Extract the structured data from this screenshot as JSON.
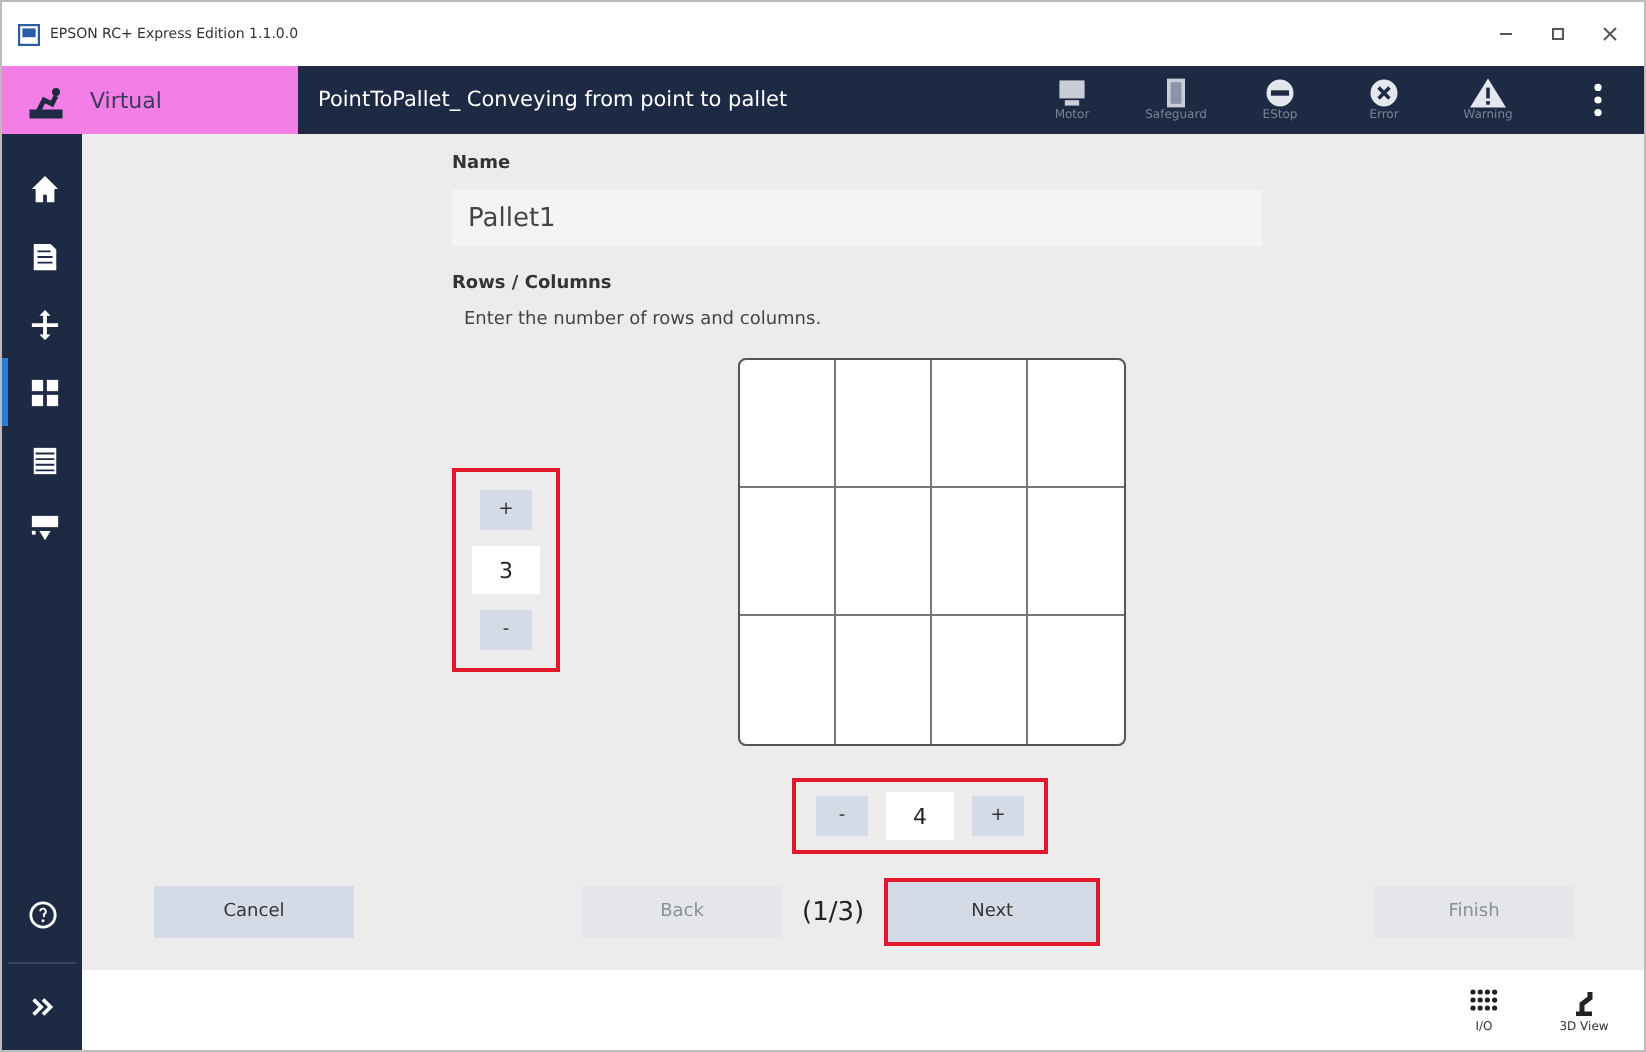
{
  "window": {
    "title": "EPSON RC+ Express Edition 1.1.0.0"
  },
  "header": {
    "mode": "Virtual",
    "title": "PointToPallet_ Conveying from point to pallet",
    "status_icons": [
      {
        "kind": "motor",
        "label": "Motor"
      },
      {
        "kind": "safeguard",
        "label": "Safeguard"
      },
      {
        "kind": "estop",
        "label": "EStop"
      },
      {
        "kind": "error",
        "label": "Error"
      },
      {
        "kind": "warning",
        "label": "Warning"
      }
    ]
  },
  "sidebar": {
    "items": [
      {
        "kind": "home",
        "selected": false
      },
      {
        "kind": "program",
        "selected": false
      },
      {
        "kind": "jog",
        "selected": false
      },
      {
        "kind": "pallet",
        "selected": true
      },
      {
        "kind": "list",
        "selected": false
      },
      {
        "kind": "spel",
        "selected": false
      }
    ]
  },
  "form": {
    "name_label": "Name",
    "name_value": "Pallet1",
    "rows_label": "Rows / Columns",
    "hint": "Enter the number of rows and columns.",
    "row_stepper": {
      "plus": "+",
      "value": "3",
      "minus": "-",
      "highlighted": true
    },
    "column_stepper": {
      "minus": "-",
      "value": "4",
      "plus": "+",
      "highlighted": true
    }
  },
  "footer": {
    "buttons": [
      {
        "label": "Cancel",
        "disabled": false,
        "highlighted": false
      },
      {
        "label": "Back",
        "disabled": true,
        "highlighted": false
      },
      {
        "label": "Next",
        "disabled": false,
        "highlighted": true
      },
      {
        "label": "Finish",
        "disabled": true,
        "highlighted": false
      }
    ],
    "page": "(1/3)"
  },
  "bottom_bar": [
    {
      "kind": "io",
      "label": "I/O"
    },
    {
      "kind": "view3d",
      "label": "3D View"
    }
  ]
}
